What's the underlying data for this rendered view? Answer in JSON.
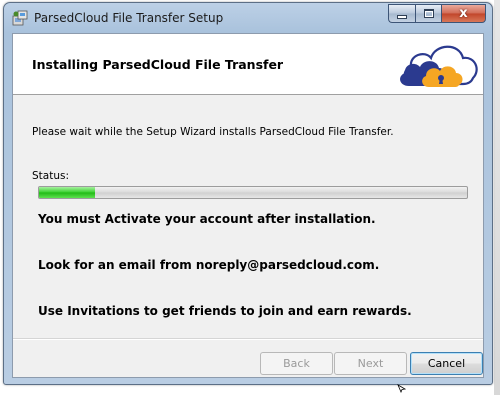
{
  "window": {
    "title": "ParsedCloud File Transfer Setup",
    "close_glyph": "x"
  },
  "banner": {
    "title": "Installing ParsedCloud File Transfer",
    "logo_icon": "cloud-lock-icon"
  },
  "content": {
    "description": "Please wait while the Setup Wizard installs ParsedCloud File Transfer.",
    "status_label": "Status:",
    "progress": 0.13,
    "messages": [
      "You must Activate your account after installation.",
      "Look for an email from noreply@parsedcloud.com.",
      "Use Invitations to get friends to join and earn rewards."
    ]
  },
  "buttons": {
    "back": "Back",
    "next": "Next",
    "cancel": "Cancel"
  },
  "colors": {
    "progress_fill": "#2ec422",
    "logo_blue": "#2b3a8f",
    "logo_orange": "#f5a623"
  }
}
